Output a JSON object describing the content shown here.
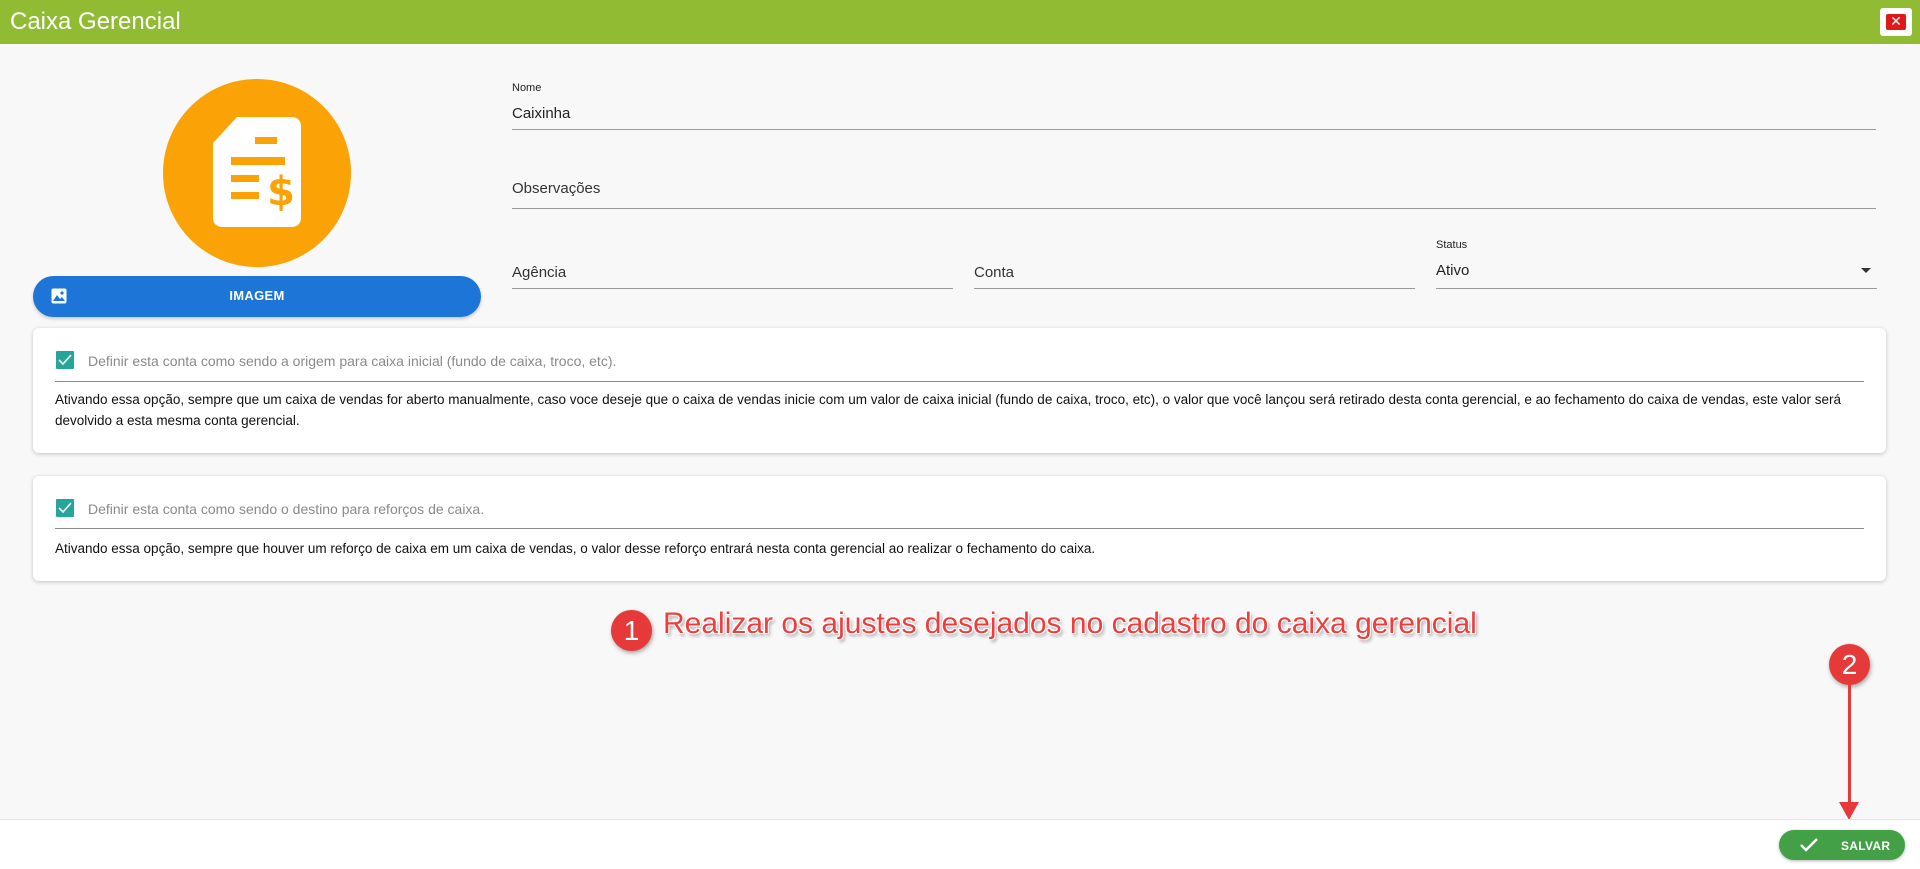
{
  "window": {
    "title": "Caixa Gerencial",
    "close_icon": "close-icon"
  },
  "image_button": {
    "label": "IMAGEM",
    "icon": "image-icon"
  },
  "avatar": {
    "icon": "invoice-dollar-icon",
    "color": "#fba206"
  },
  "form": {
    "nome": {
      "label": "Nome",
      "value": "Caixinha"
    },
    "observacoes": {
      "placeholder": "Observações"
    },
    "agencia": {
      "placeholder": "Agência"
    },
    "conta": {
      "placeholder": "Conta"
    },
    "status": {
      "label": "Status",
      "value": "Ativo"
    }
  },
  "options": [
    {
      "checked": true,
      "label": "Definir esta conta como sendo a origem para caixa inicial (fundo de caixa, troco, etc).",
      "description": "Ativando essa opção, sempre que um caixa de vendas for aberto manualmente, caso voce deseje que o caixa de vendas inicie com um valor de caixa inicial (fundo de caixa, troco, etc), o valor que você lançou será retirado desta conta gerencial, e ao fechamento do caixa de vendas, este valor será devolvido a esta mesma conta gerencial."
    },
    {
      "checked": true,
      "label": "Definir esta conta como sendo o destino para reforços de caixa.",
      "description": "Ativando essa opção, sempre que houver um reforço de caixa em um caixa de vendas, o valor desse reforço entrará nesta conta gerencial ao realizar o fechamento do caixa."
    }
  ],
  "annotations": {
    "step1_number": "1",
    "step1_text": "Realizar os ajustes desejados no cadastro do caixa gerencial",
    "step2_number": "2"
  },
  "footer": {
    "save_label": "SALVAR",
    "save_icon": "check-icon"
  },
  "colors": {
    "header": "#92bb34",
    "primary": "#1e75d8",
    "checkbox": "#26a69a",
    "save": "#43a047",
    "annotation": "#e63a3a"
  }
}
